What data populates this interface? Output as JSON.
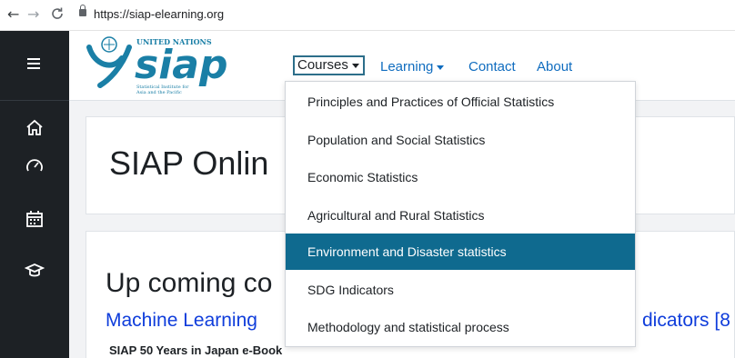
{
  "browser": {
    "url": "https://siap-elearning.org"
  },
  "logo": {
    "org": "UNITED NATIONS",
    "name": "siap",
    "tagline_lines": [
      "Statistical Institute for",
      "Asia and the Pacific"
    ]
  },
  "nav": {
    "courses_label": "Courses",
    "learning_label": "Learning",
    "contact_label": "Contact",
    "about_label": "About"
  },
  "dropdown": {
    "items": [
      {
        "label": "Principles and Practices of Official Statistics",
        "active": false
      },
      {
        "label": "Population and Social Statistics",
        "active": false
      },
      {
        "label": "Economic Statistics",
        "active": false
      },
      {
        "label": "Agricultural and Rural Statistics",
        "active": false
      },
      {
        "label": "Environment and Disaster statistics",
        "active": true
      },
      {
        "label": "SDG Indicators",
        "active": false
      },
      {
        "label": "Methodology and statistical process",
        "active": false
      }
    ]
  },
  "main": {
    "page_title": "SIAP Onlin",
    "upcoming_heading": "Up coming co",
    "course_link_left": "Machine Learning",
    "course_link_right": "dicators [8",
    "ebook_text": "SIAP 50 Years in Japan e-Book"
  },
  "sidebar": {
    "icons": [
      "menu-icon",
      "home-icon",
      "dashboard-icon",
      "calendar-icon",
      "graduation-cap-icon"
    ]
  },
  "colors": {
    "sidebar": "#1d2125",
    "link": "#0f6cbf",
    "active_item": "#0f6a8f",
    "logo": "#1a7fa6"
  }
}
